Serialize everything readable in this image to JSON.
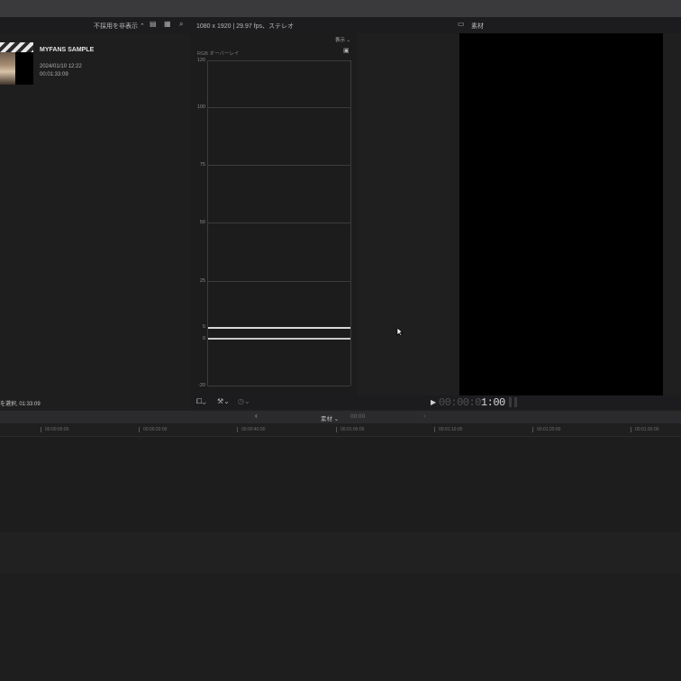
{
  "toolbar": {
    "filter_label": "不採用を非表示",
    "format_info": "1080 x 1920 | 29.97 fps、ステレオ",
    "viewer_title": "素材"
  },
  "browser": {
    "clip": {
      "title": "MYFANS SAMPLE",
      "date": "2024/01/10 12:22",
      "duration": "00:01:33:09"
    },
    "status": "を選択, 01:33:09"
  },
  "scopes": {
    "view_menu": "表示 ⌄",
    "scope_name": "RGB オーバーレイ",
    "axis_labels": [
      "120",
      "100",
      "75",
      "50",
      "25",
      "5",
      "0",
      "-20"
    ]
  },
  "viewer": {
    "timecode_dim": "00:00:0",
    "timecode_bright": "1:00"
  },
  "timeline": {
    "clip_menu": "素材",
    "timecode": "00:00",
    "ruler_ticks": [
      "00:00:00:00",
      "00:00:20:00",
      "00:00:40:00",
      "00:01:00:00",
      "00:01:10:00",
      "00:01:20:00",
      "00:01:30:00"
    ]
  }
}
